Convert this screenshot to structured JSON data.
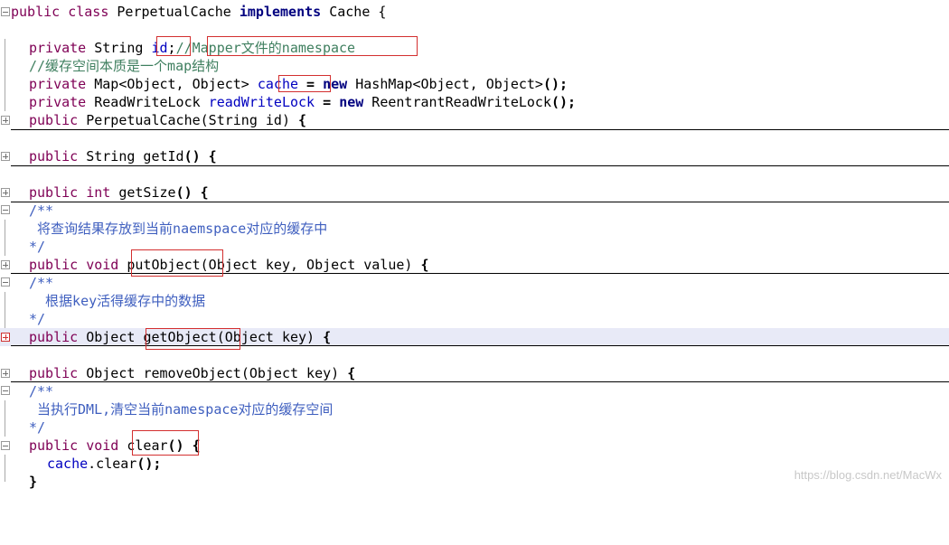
{
  "code": {
    "class_decl": {
      "mod": "public class ",
      "name": "PerpetualCache ",
      "kw": "implements",
      "iface": " Cache {"
    },
    "field_id": {
      "mod": "private",
      "type": " String ",
      "name": "id",
      "semi": ";",
      "comment": "//Mapper文件的namespace"
    },
    "comment_cache": "//缓存空间本质是一个map结构",
    "field_cache": {
      "mod": "private",
      "type": " Map<Object, Object> ",
      "name": "cache",
      "eq": " = ",
      "kw": "new",
      "rest": " HashMap<Object, Object>",
      "end": "();"
    },
    "field_lock": {
      "mod": "private",
      "type": " ReadWriteLock ",
      "name": "readWriteLock",
      "eq": " = ",
      "kw": "new",
      "rest": " ReentrantReadWriteLock",
      "end": "();"
    },
    "constructor": {
      "mod": "public",
      "sig": " PerpetualCache(String id) ",
      "brace": "{"
    },
    "get_id": {
      "mod": "public",
      "sig": " String getId",
      "parens": "()",
      "brace": " {"
    },
    "get_size": {
      "mod": "public int",
      "sig": " getSize",
      "parens": "()",
      "brace": " {"
    },
    "doc1_open": "/**",
    "doc1_text": " 将查询结果存放到当前naemspace对应的缓存中",
    "doc1_close": "*/",
    "put_object": {
      "mod": "public void",
      "name": " putObject",
      "params": "(Object key, Object value) ",
      "brace": "{"
    },
    "doc2_open": "/**",
    "doc2_text": "  根据key活得缓存中的数据",
    "doc2_close": "*/",
    "get_object": {
      "mod": "public",
      "type": " Object ",
      "name": "getObject",
      "params": "(Object key) ",
      "brace": "{"
    },
    "remove_object": {
      "mod": "public",
      "type": " Object ",
      "name": "removeObject",
      "params": "(Object key) ",
      "brace": "{"
    },
    "doc3_open": "/**",
    "doc3_text": " 当执行DML,清空当前namespace对应的缓存空间",
    "doc3_close": "*/",
    "clear": {
      "mod": "public void",
      "name": " clear",
      "parens": "()",
      "brace": " {"
    },
    "clear_body": {
      "obj": "cache",
      "call": ".clear",
      "end": "();"
    },
    "closing_brace": "}"
  },
  "colors": {
    "keyword": "#7f0055",
    "keyword_bold": "#00007f",
    "field": "#0000c0",
    "comment": "#3f7f5f",
    "javadoc": "#3f5fbf",
    "annotation_box": "#d32f2f",
    "current_line": "#e8eaf7"
  },
  "watermark": "https://blog.csdn.net/MacWx"
}
